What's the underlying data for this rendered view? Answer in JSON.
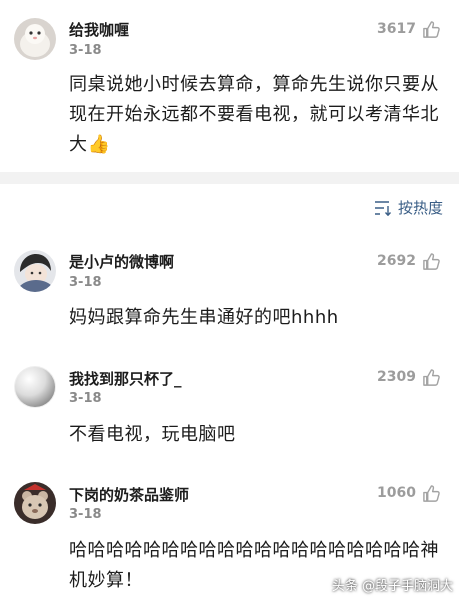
{
  "comments": [
    {
      "user": "给我咖喱",
      "date": "3-18",
      "likes": "3617",
      "text": "同桌说她小时候去算命，算命先生说你只要从现在开始永远都不要看电视，就可以考清华北大👍"
    },
    {
      "user": "是小卢的微博啊",
      "date": "3-18",
      "likes": "2692",
      "text": "妈妈跟算命先生串通好的吧hhhh"
    },
    {
      "user": "我找到那只杯了_",
      "date": "3-18",
      "likes": "2309",
      "text": "不看电视，玩电脑吧"
    },
    {
      "user": "下岗的奶茶品鉴师",
      "date": "3-18",
      "likes": "1060",
      "text": "哈哈哈哈哈哈哈哈哈哈哈哈哈哈哈哈哈哈哈神机妙算！"
    }
  ],
  "sort": {
    "label": "按热度",
    "icon": "sort-icon"
  },
  "watermark": "头条 @段子手脑洞大"
}
